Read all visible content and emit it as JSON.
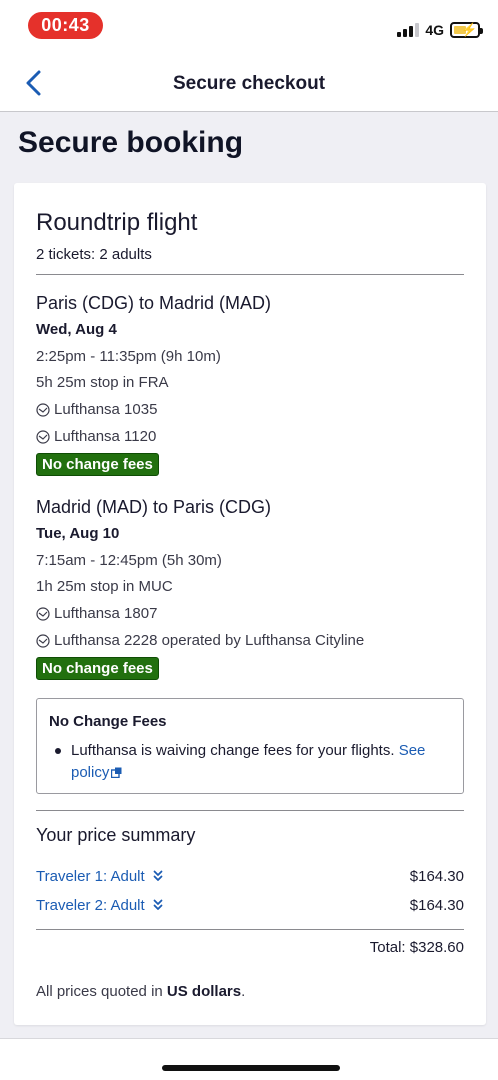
{
  "status_bar": {
    "time": "00:43",
    "network": "4G"
  },
  "nav": {
    "title": "Secure checkout",
    "back_icon": "chevron-left-icon"
  },
  "page": {
    "heading": "Secure booking"
  },
  "trip": {
    "title": "Roundtrip flight",
    "tickets": "2 tickets: 2 adults",
    "legs": [
      {
        "route": "Paris (CDG) to Madrid (MAD)",
        "date": "Wed, Aug 4",
        "times": "2:25pm - 11:35pm (9h 10m)",
        "stop": "5h 25m stop in FRA",
        "flights": [
          "Lufthansa 1035",
          "Lufthansa 1120"
        ],
        "badge": "No change fees"
      },
      {
        "route": "Madrid (MAD) to Paris (CDG)",
        "date": "Tue, Aug 10",
        "times": "7:15am - 12:45pm (5h 30m)",
        "stop": "1h 25m stop in MUC",
        "flights": [
          "Lufthansa 1807",
          "Lufthansa 2228 operated by Lufthansa Cityline"
        ],
        "badge": "No change fees"
      }
    ]
  },
  "notice": {
    "title": "No Change Fees",
    "body": "Lufthansa is waiving change fees for your flights. ",
    "link": "See policy"
  },
  "price_summary": {
    "title": "Your price summary",
    "travelers": [
      {
        "label": "Traveler 1: Adult",
        "amount": "$164.30"
      },
      {
        "label": "Traveler 2: Adult",
        "amount": "$164.30"
      }
    ],
    "total": "Total: $328.60",
    "disclaimer_prefix": "All prices quoted in ",
    "disclaimer_bold": "US dollars",
    "disclaimer_suffix": "."
  },
  "colors": {
    "accent": "#1b5cb3",
    "badge_green": "#22700f",
    "time_pill": "#e5312b"
  }
}
